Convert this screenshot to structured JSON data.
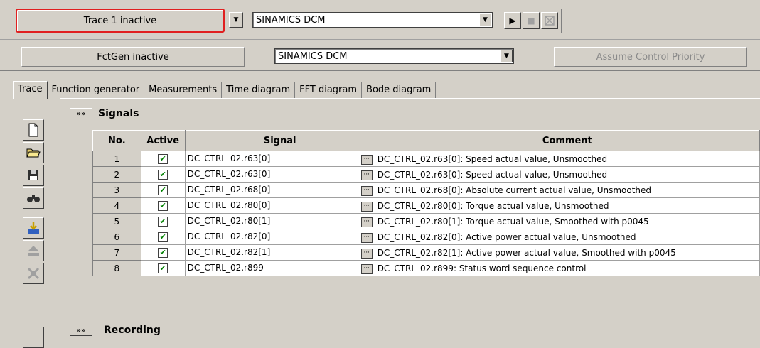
{
  "toolbar1": {
    "trace_button": "Trace 1 inactive",
    "device": "SINAMICS DCM",
    "play_icon": "play-icon",
    "stop_icon": "stop-icon",
    "erase_icon": "erase-icon"
  },
  "toolbar2": {
    "fctgen_button": "FctGen  inactive",
    "device": "SINAMICS DCM",
    "assume_button": "Assume Control Priority"
  },
  "tabs": [
    {
      "label": "Trace",
      "active": true
    },
    {
      "label": "Function generator"
    },
    {
      "label": "Measurements"
    },
    {
      "label": "Time diagram"
    },
    {
      "label": "FFT diagram"
    },
    {
      "label": "Bode diagram"
    }
  ],
  "sections": {
    "signals": {
      "toggle": "»»",
      "title": "Signals"
    },
    "recording": {
      "toggle": "»»",
      "title": "Recording"
    }
  },
  "table": {
    "headers": {
      "no": "No.",
      "active": "Active",
      "signal": "Signal",
      "comment": "Comment"
    },
    "rows": [
      {
        "no": "1",
        "active": true,
        "signal": "DC_CTRL_02.r63[0]",
        "comment": "DC_CTRL_02.r63[0]: Speed actual value, Unsmoothed"
      },
      {
        "no": "2",
        "active": true,
        "signal": "DC_CTRL_02.r63[0]",
        "comment": "DC_CTRL_02.r63[0]: Speed actual value, Unsmoothed"
      },
      {
        "no": "3",
        "active": true,
        "signal": "DC_CTRL_02.r68[0]",
        "comment": "DC_CTRL_02.r68[0]: Absolute current actual value, Unsmoothed"
      },
      {
        "no": "4",
        "active": true,
        "signal": "DC_CTRL_02.r80[0]",
        "comment": "DC_CTRL_02.r80[0]: Torque actual value, Unsmoothed"
      },
      {
        "no": "5",
        "active": true,
        "signal": "DC_CTRL_02.r80[1]",
        "comment": "DC_CTRL_02.r80[1]: Torque actual value, Smoothed with p0045"
      },
      {
        "no": "6",
        "active": true,
        "signal": "DC_CTRL_02.r82[0]",
        "comment": "DC_CTRL_02.r82[0]: Active power actual value, Unsmoothed"
      },
      {
        "no": "7",
        "active": true,
        "signal": "DC_CTRL_02.r82[1]",
        "comment": "DC_CTRL_02.r82[1]: Active power actual value, Smoothed with p0045"
      },
      {
        "no": "8",
        "active": true,
        "signal": "DC_CTRL_02.r899",
        "comment": "DC_CTRL_02.r899: Status word sequence control"
      }
    ]
  },
  "side_icons": [
    "new-file-icon",
    "open-folder-icon",
    "save-icon",
    "find-icon",
    "import-icon",
    "export-icon",
    "delete-icon"
  ]
}
